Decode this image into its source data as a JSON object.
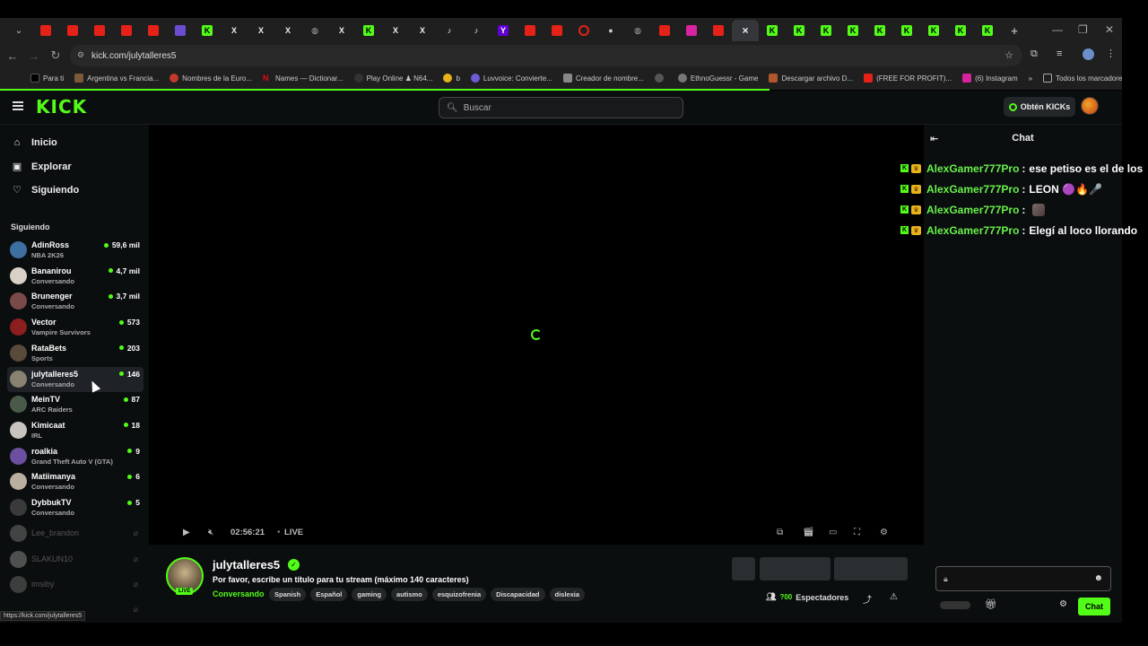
{
  "browser": {
    "url": "kick.com/julytalleres5",
    "bookmarks": [
      "Para ti",
      "Argentina vs Francia...",
      "Nombres de la Euro...",
      "Names — Dictionar...",
      "Play Online ♟ N64...",
      "b",
      "Luvvoice: Convierte...",
      "Creador de nombre...",
      "EthnoGuessr - Game",
      "Descargar archivo D...",
      "(FREE FOR PROFIT)...",
      "(6) Instagram",
      "Todos los marcadores"
    ],
    "tab_close": "×",
    "new_tab": "+",
    "bookmarks_more": "»"
  },
  "topbar": {
    "logo": "KICK",
    "search_placeholder": "Buscar",
    "get_kicks": "Obtén KICKs"
  },
  "sidebar": {
    "nav": [
      {
        "label": "Inicio",
        "icon": "home-icon"
      },
      {
        "label": "Explorar",
        "icon": "browse-icon"
      },
      {
        "label": "Siguiendo",
        "icon": "heart-icon"
      }
    ],
    "following_title": "Siguiendo",
    "channels": [
      {
        "name": "AdinRoss",
        "category": "NBA 2K26",
        "viewers": "59,6 mil",
        "color": "#3d6fa0"
      },
      {
        "name": "Bananirou",
        "category": "Conversando",
        "viewers": "4,7 mil",
        "color": "#d7d2c5"
      },
      {
        "name": "Brunenger",
        "category": "Conversando",
        "viewers": "3,7 mil",
        "color": "#7a4a4a"
      },
      {
        "name": "Vector",
        "category": "Vampire Survivors",
        "viewers": "573",
        "color": "#8b1e1e"
      },
      {
        "name": "RataBets",
        "category": "Sports",
        "viewers": "203",
        "color": "#5a4a3a"
      },
      {
        "name": "julytalleres5",
        "category": "Conversando",
        "viewers": "146",
        "color": "#8a8270"
      },
      {
        "name": "MeinTV",
        "category": "ARC Raiders",
        "viewers": "87",
        "color": "#4a5a4a"
      },
      {
        "name": "Kimicaat",
        "category": "IRL",
        "viewers": "18",
        "color": "#c9c3c0"
      },
      {
        "name": "roalkia",
        "category": "Grand Theft Auto V (GTA)",
        "viewers": "9",
        "color": "#6b4fa0"
      },
      {
        "name": "Matiimanya",
        "category": "Conversando",
        "viewers": "6",
        "color": "#b9b0a0"
      },
      {
        "name": "DybbukTV",
        "category": "Conversando",
        "viewers": "5",
        "color": "#3a3a3a"
      }
    ],
    "offline": [
      "Lee_brandon",
      "SLAKUN10",
      "imsiby"
    ],
    "status_url": "https://kick.com/julytalleres5"
  },
  "player": {
    "time": "02:56:21",
    "live_label": "LIVE"
  },
  "stream": {
    "live_badge": "LIVE",
    "streamer": "julytalleres5",
    "title": "Por favor, escribe un título para tu stream (máximo 140 caracteres)",
    "category": "Conversando",
    "tags": [
      "Spanish",
      "Español",
      "gaming",
      "autismo",
      "esquizofrenia",
      "Discapacidad",
      "dislexia"
    ],
    "viewers_label": "Espectadores",
    "viewers_count": "?00"
  },
  "chat": {
    "title": "Chat",
    "messages": [
      {
        "user": "AlexGamer777Pro",
        "text": "ese petiso es el de los"
      },
      {
        "user": "AlexGamer777Pro",
        "text": "LEON 🟣🔥🎤"
      },
      {
        "user": "AlexGamer777Pro",
        "text": ""
      },
      {
        "user": "AlexGamer777Pro",
        "text": "Elegí al loco llorando"
      }
    ],
    "send_label": "Chat",
    "colors": {
      "accent": "#53fc18",
      "username": "#68f24a"
    }
  }
}
